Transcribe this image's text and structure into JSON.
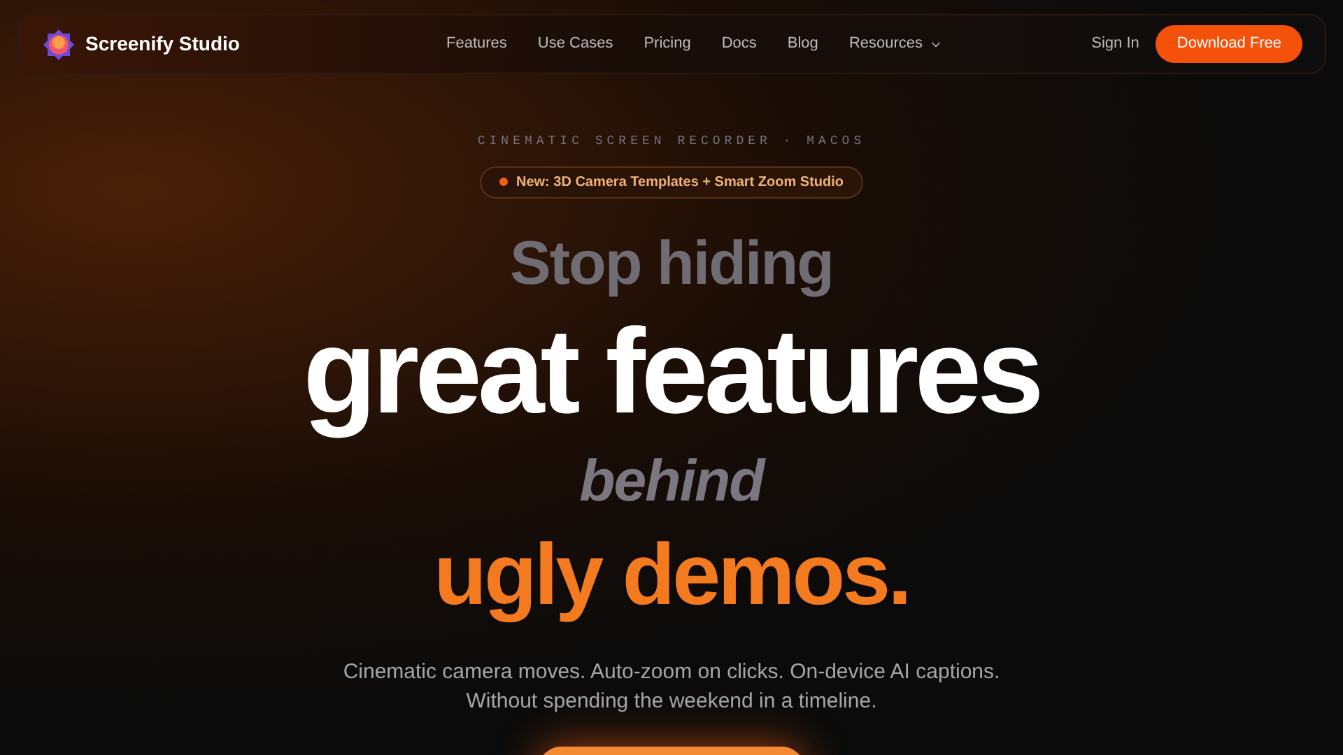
{
  "nav": {
    "brand": "Screenify Studio",
    "links": [
      {
        "label": "Features",
        "kind": "link"
      },
      {
        "label": "Use Cases",
        "kind": "link"
      },
      {
        "label": "Pricing",
        "kind": "link"
      },
      {
        "label": "Docs",
        "kind": "link"
      },
      {
        "label": "Blog",
        "kind": "link"
      },
      {
        "label": "Resources",
        "kind": "dropdown"
      }
    ],
    "sign_in": "Sign In",
    "download": "Download Free"
  },
  "hero": {
    "eyebrow": "CINEMATIC SCREEN RECORDER · MACOS",
    "badge": "New: 3D Camera Templates + Smart Zoom Studio",
    "headline": [
      {
        "text": "Stop hiding",
        "kind": "muted"
      },
      {
        "text": "great features",
        "kind": "strong"
      },
      {
        "text": "behind",
        "kind": "italic"
      },
      {
        "text": "ugly demos.",
        "kind": "accent"
      }
    ],
    "subtitle": [
      "Cinematic camera moves. Auto-zoom on clicks. On-device AI captions.",
      "Without spending the weekend in a timeline."
    ]
  }
}
